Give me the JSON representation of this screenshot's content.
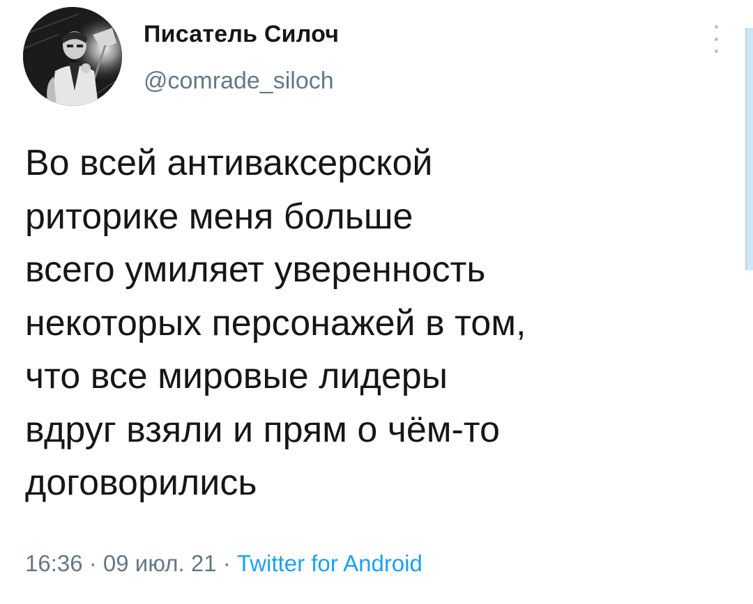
{
  "author": {
    "display_name": "Писатель Силоч",
    "handle": "@comrade_siloch",
    "avatar_icon": "avatar-noir-photo"
  },
  "tweet": {
    "text": "Во всей антиваксерской\nриторике меня больше\nвсего умиляет уверенность\nнекоторых персонажей в том,\nчто все мировые лидеры\nвдруг взяли и прям о чём-то\nдоговорились"
  },
  "meta": {
    "time": "16:36",
    "separator1": " · ",
    "date": "09 июл. 21",
    "separator2": " · ",
    "source": "Twitter for Android"
  },
  "icons": {
    "menu": "more-vertical-icon"
  },
  "colors": {
    "text": "#14171a",
    "secondary": "#657786",
    "accent": "#1da1f2"
  }
}
